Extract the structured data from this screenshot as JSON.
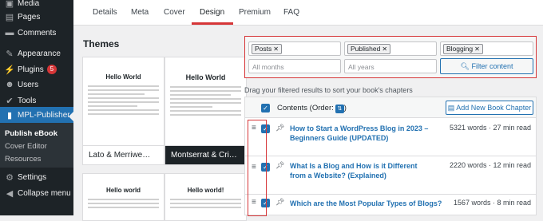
{
  "sidebar": {
    "items": [
      {
        "label": "Media",
        "icon": "media-icon"
      },
      {
        "label": "Pages",
        "icon": "pages-icon"
      },
      {
        "label": "Comments",
        "icon": "comments-icon"
      },
      {
        "label": "Appearance",
        "icon": "appearance-icon"
      },
      {
        "label": "Plugins",
        "icon": "plugins-icon",
        "badge": "5"
      },
      {
        "label": "Users",
        "icon": "users-icon"
      },
      {
        "label": "Tools",
        "icon": "tools-icon"
      },
      {
        "label": "MPL-Publisher",
        "icon": "book-icon"
      },
      {
        "label": "Settings",
        "icon": "settings-icon"
      },
      {
        "label": "Collapse menu",
        "icon": "collapse-icon"
      }
    ],
    "submenu": [
      "Publish eBook",
      "Cover Editor",
      "Resources"
    ]
  },
  "tabs": [
    "Details",
    "Meta",
    "Cover",
    "Design",
    "Premium",
    "FAQ"
  ],
  "active_tab": "Design",
  "themes": {
    "title": "Themes",
    "cards": [
      {
        "name": "Lato & Merriwe…",
        "preview_title": "Hello World",
        "selected": false
      },
      {
        "name": "Montserrat & Cri…",
        "preview_title": "Hello World",
        "selected": true
      },
      {
        "name": "",
        "preview_title": "Hello world",
        "selected": false
      },
      {
        "name": "",
        "preview_title": "Hello world!",
        "selected": false
      }
    ]
  },
  "filters": {
    "post_type_tag": "Posts",
    "status_tag": "Published",
    "category_tag": "Blogging",
    "months": "All months",
    "years": "All years",
    "button": "Filter content"
  },
  "drag_hint": "Drag your filtered results to sort your book's chapters",
  "chapters": {
    "header_label": "Contents (Order:",
    "add_button": "Add New Book Chapter",
    "rows": [
      {
        "title": "How to Start a WordPress Blog in 2023 – Beginners Guide (UPDATED)",
        "meta": "5321 words · 27 min read"
      },
      {
        "title": "What Is a Blog and How is it Different from a Website? (Explained)",
        "meta": "2220 words · 12 min read"
      },
      {
        "title": "Which are the Most Popular Types of Blogs?",
        "meta": "1567 words · 8 min read"
      }
    ]
  },
  "colors": {
    "accent": "#2271b1",
    "highlight": "#d63638",
    "sidebar": "#1d2327"
  }
}
